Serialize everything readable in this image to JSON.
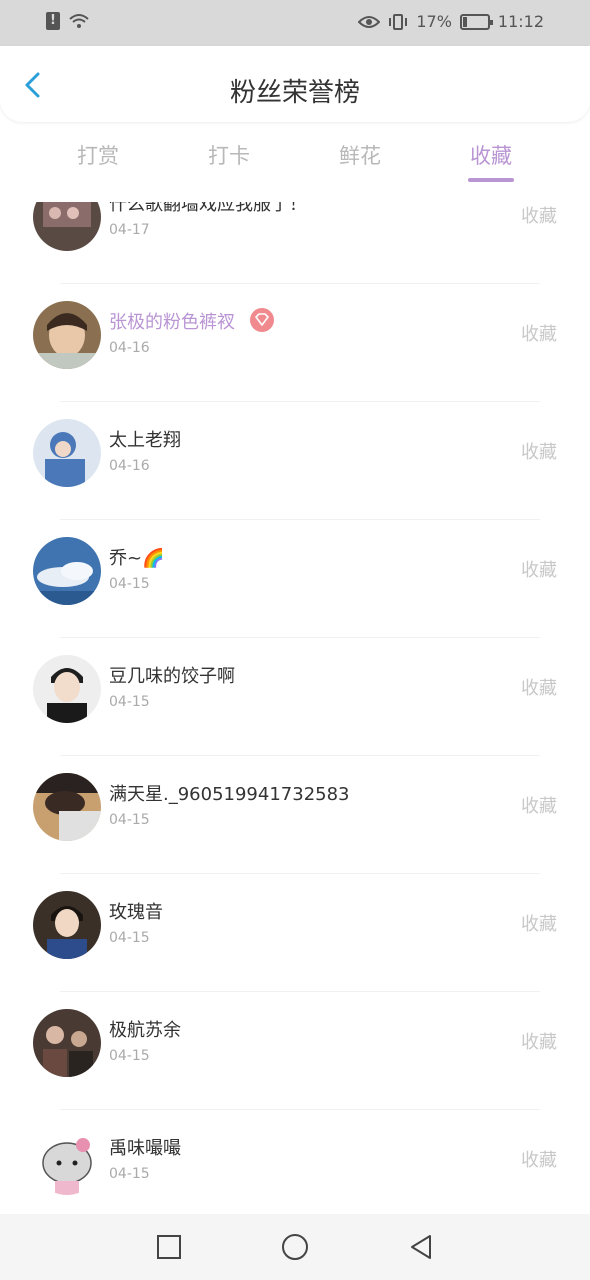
{
  "status_bar": {
    "battery": "17%",
    "time": "11:12"
  },
  "header": {
    "title": "粉丝荣誉榜"
  },
  "tabs": [
    {
      "label": "打赏"
    },
    {
      "label": "打卡"
    },
    {
      "label": "鲜花"
    },
    {
      "label": "收藏"
    }
  ],
  "rows": [
    {
      "name": "什么歌翻墙戏应我服了！",
      "date": "04-17",
      "action": "收藏"
    },
    {
      "name": "张极的粉色裤衩",
      "date": "04-16",
      "action": "收藏"
    },
    {
      "name": "太上老翔",
      "date": "04-16",
      "action": "收藏"
    },
    {
      "name": "乔~🌈",
      "date": "04-15",
      "action": "收藏"
    },
    {
      "name": "豆几味的饺子啊",
      "date": "04-15",
      "action": "收藏"
    },
    {
      "name": "满天星._960519941732583",
      "date": "04-15",
      "action": "收藏"
    },
    {
      "name": "玫瑰音",
      "date": "04-15",
      "action": "收藏"
    },
    {
      "name": "极航苏余",
      "date": "04-15",
      "action": "收藏"
    },
    {
      "name": "禹味嘬嘬",
      "date": "04-15",
      "action": "收藏"
    }
  ],
  "colors": {
    "accent": "#b995d4",
    "back": "#2b9fd9",
    "badge": "#f08a8f"
  }
}
